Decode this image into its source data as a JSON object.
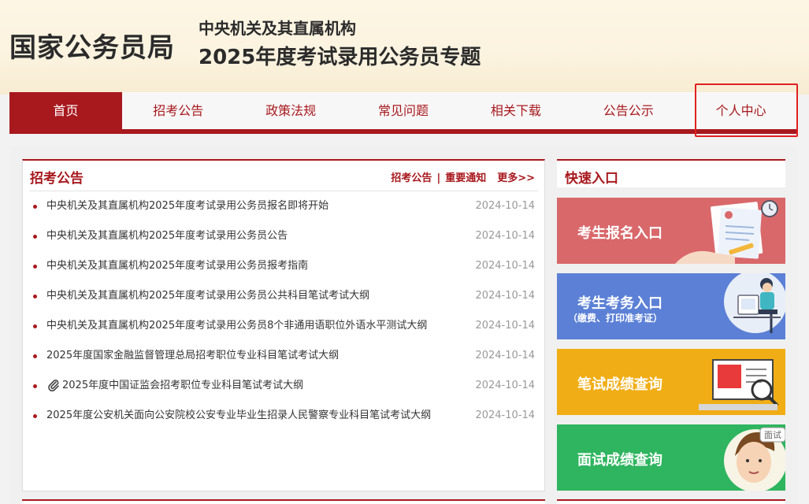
{
  "header": {
    "site_title": "国家公务员局",
    "subtitle_line1": "中央机关及其直属机构",
    "subtitle_line2": "2025年度考试录用公务员专题"
  },
  "nav": {
    "items": [
      {
        "label": "首页",
        "active": true
      },
      {
        "label": "招考公告",
        "active": false
      },
      {
        "label": "政策法规",
        "active": false
      },
      {
        "label": "常见问题",
        "active": false
      },
      {
        "label": "相关下载",
        "active": false
      },
      {
        "label": "公告公示",
        "active": false
      },
      {
        "label": "个人中心",
        "active": false,
        "highlighted": true
      }
    ]
  },
  "announcements": {
    "title": "招考公告",
    "links": [
      "招考公告",
      "重要通知"
    ],
    "separator": "|",
    "more": "更多>>",
    "items": [
      {
        "title": "中央机关及其直属机构2025年度考试录用公务员报名即将开始",
        "date": "2024-10-14",
        "attachment": false
      },
      {
        "title": "中央机关及其直属机构2025年度考试录用公务员公告",
        "date": "2024-10-14",
        "attachment": false
      },
      {
        "title": "中央机关及其直属机构2025年度考试录用公务员报考指南",
        "date": "2024-10-14",
        "attachment": false
      },
      {
        "title": "中央机关及其直属机构2025年度考试录用公务员公共科目笔试考试大纲",
        "date": "2024-10-14",
        "attachment": false
      },
      {
        "title": "中央机关及其直属机构2025年度考试录用公务员8个非通用语职位外语水平测试大纲",
        "date": "2024-10-14",
        "attachment": false
      },
      {
        "title": "2025年度国家金融监督管理总局招考职位专业科目笔试考试大纲",
        "date": "2024-10-14",
        "attachment": false
      },
      {
        "title": "2025年度中国证监会招考职位专业科目笔试考试大纲",
        "date": "2024-10-14",
        "attachment": true
      },
      {
        "title": "2025年度公安机关面向公安院校公安专业毕业生招录人民警察专业科目笔试考试大纲",
        "date": "2024-10-14",
        "attachment": false
      }
    ]
  },
  "quick_entry": {
    "title": "快速入口",
    "buttons": [
      {
        "label": "考生报名入口",
        "sublabel": "",
        "color": "#d9686b",
        "icon": "document-form-icon"
      },
      {
        "label": "考生考务入口",
        "sublabel": "（缴费、打印准考证）",
        "color": "#5b80d6",
        "icon": "person-at-computer-icon"
      },
      {
        "label": "笔试成绩查询",
        "sublabel": "",
        "color": "#f1ad15",
        "icon": "exam-board-icon"
      },
      {
        "label": "面试成绩查询",
        "sublabel": "",
        "color": "#2fb55f",
        "icon": "interview-person-icon",
        "badge": "面试"
      }
    ]
  },
  "colors": {
    "brand_red": "#a8191e",
    "highlight_border": "#e02020"
  }
}
